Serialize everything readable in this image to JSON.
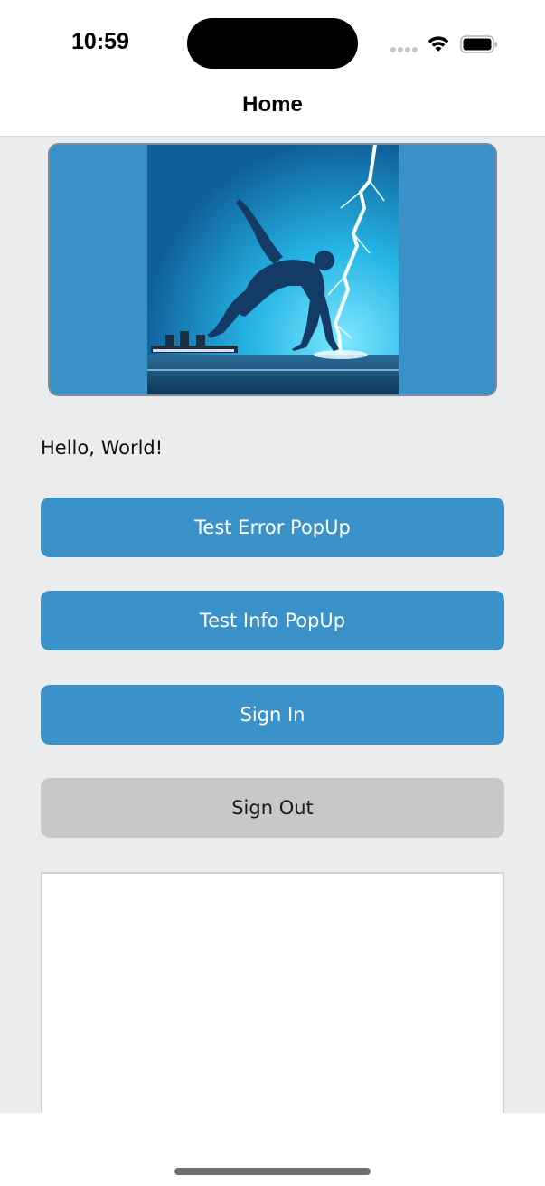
{
  "status_bar": {
    "time": "10:59",
    "signal_icon": "cellular-signal-icon",
    "wifi_icon": "wifi-icon",
    "battery_icon": "battery-icon"
  },
  "nav": {
    "title": "Home"
  },
  "hero": {
    "image_description_icon": "sprinter-lightning-image",
    "colors": {
      "frame": "#3a91c7",
      "border": "#7d8c98"
    }
  },
  "greeting": "Hello, World!",
  "buttons": {
    "test_error": "Test Error PopUp",
    "test_info": "Test Info PopUp",
    "sign_in": "Sign In",
    "sign_out": "Sign Out"
  },
  "log_box": {
    "value": ""
  },
  "colors": {
    "primary": "#3b92c8",
    "muted": "#c8c8c8",
    "background": "#ebecee"
  }
}
